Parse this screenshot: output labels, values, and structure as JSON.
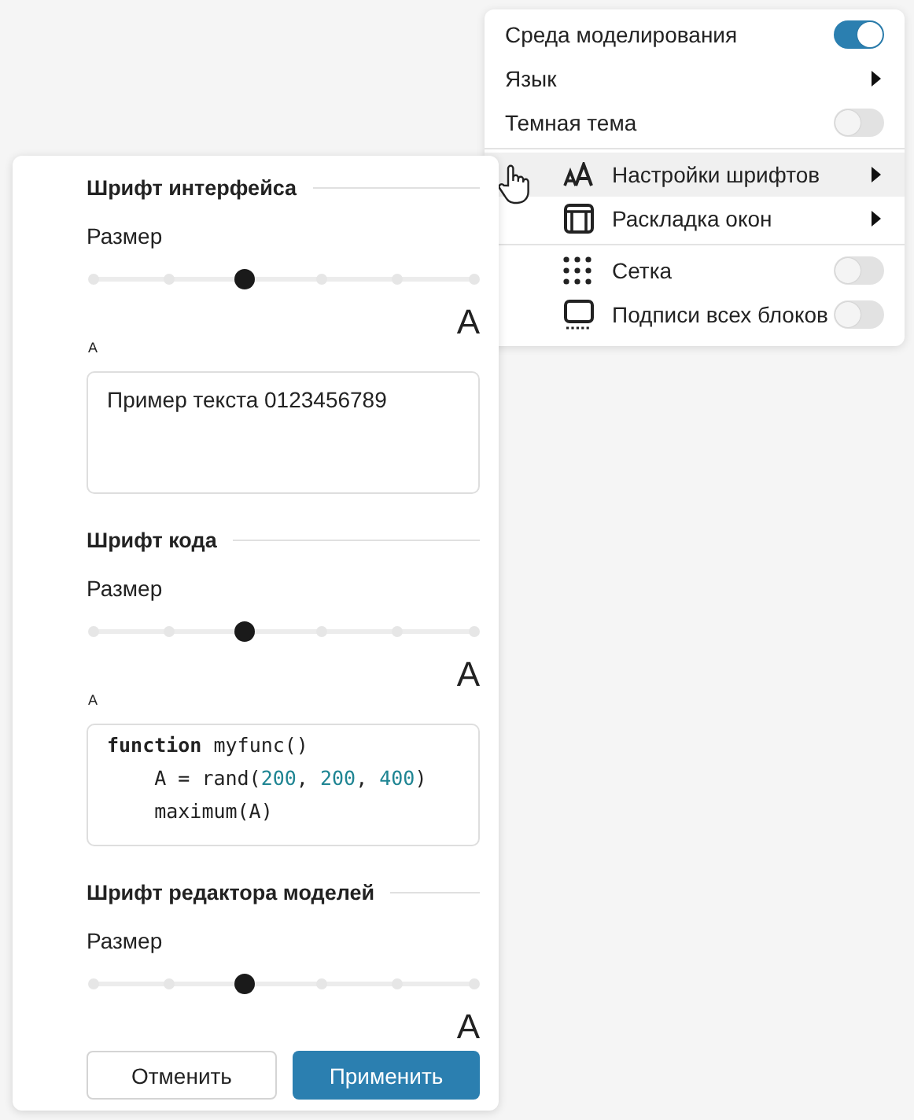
{
  "menu": {
    "groups": [
      [
        {
          "kind": "toggle",
          "label": "Среда моделирования",
          "on": true
        },
        {
          "kind": "submenu",
          "label": "Язык"
        },
        {
          "kind": "toggle",
          "label": "Темная тема",
          "on": false
        }
      ],
      [
        {
          "kind": "submenu",
          "label": "Настройки шрифтов",
          "selected": true
        },
        {
          "kind": "submenu",
          "label": "Раскладка окон",
          "selected": false
        }
      ],
      [
        {
          "kind": "toggle",
          "label": "Сетка",
          "on": false
        },
        {
          "kind": "toggle",
          "label": "Подписи всех блоков",
          "on": false
        }
      ]
    ]
  },
  "font_panel": {
    "sections": [
      {
        "title": "Шрифт интерфейса",
        "size_label": "Размер",
        "level": 0.4,
        "glyph_small": "A",
        "glyph_large": "A",
        "preview": {
          "kind": "text",
          "text": "Пример текста 0123456789"
        }
      },
      {
        "title": "Шрифт кода",
        "size_label": "Размер",
        "level": 0.4,
        "glyph_small": "A",
        "glyph_large": "A",
        "preview": {
          "kind": "code",
          "lines": [
            [
              {
                "kind": "keyword",
                "text": "function"
              },
              {
                "kind": "plain",
                "text": " myfunc()"
              }
            ],
            [
              {
                "kind": "plain",
                "text": "    A = rand("
              },
              {
                "kind": "number",
                "text": "200"
              },
              {
                "kind": "plain",
                "text": ", "
              },
              {
                "kind": "number",
                "text": "200"
              },
              {
                "kind": "plain",
                "text": ", "
              },
              {
                "kind": "number",
                "text": "400"
              },
              {
                "kind": "plain",
                "text": ")"
              }
            ],
            [
              {
                "kind": "plain",
                "text": "    maximum(A)"
              }
            ]
          ]
        }
      },
      {
        "title": "Шрифт редактора моделей",
        "size_label": "Размер",
        "level": 0.4,
        "glyph_large": "A"
      }
    ],
    "buttons": [
      {
        "kind": "secondary",
        "label": "Отменить"
      },
      {
        "kind": "primary",
        "label": "Применить"
      }
    ]
  }
}
